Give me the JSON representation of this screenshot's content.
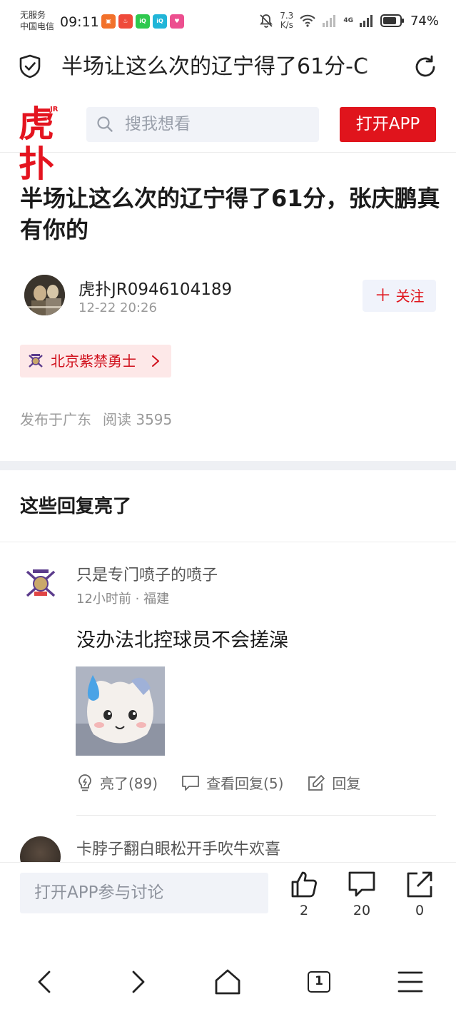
{
  "status_bar": {
    "carrier_line1": "无服务",
    "carrier_line2": "中国电信",
    "time": "09:11",
    "speed_value": "7.3",
    "speed_unit": "K/s",
    "network": "4G",
    "battery": "74%",
    "notification_icons": [
      "app-icon",
      "app-icon",
      "iqiyi-icon",
      "iqiyi-icon",
      "app-icon"
    ]
  },
  "browser": {
    "tab_title": "半场让这么次的辽宁得了61分-C",
    "tab_count": "1"
  },
  "site": {
    "search_placeholder": "搜我想看",
    "open_app_label": "打开APP",
    "brand_color": "#e0141c"
  },
  "article": {
    "title": "半场让这么次的辽宁得了61分，张庆鹏真有你的",
    "author": "虎扑JR0946104189",
    "time": "12-22 20:26",
    "follow_label": "关注",
    "team_tag": "北京紫禁勇士",
    "location": "发布于广东",
    "reads": "阅读 3595"
  },
  "comments_section": {
    "title": "这些回复亮了",
    "comments": [
      {
        "user": "只是专门喷子的喷子",
        "meta": "12小时前 · 福建",
        "body": "没办法北控球员不会搓澡",
        "light_label": "亮了(89)",
        "replies_label": "查看回复(5)",
        "reply_label": "回复"
      },
      {
        "user": "卡脖子翻白眼松开手吹牛欢喜"
      }
    ]
  },
  "bottom_bar": {
    "placeholder": "打开APP参与讨论",
    "likes": "2",
    "comments": "20",
    "shares": "0"
  }
}
